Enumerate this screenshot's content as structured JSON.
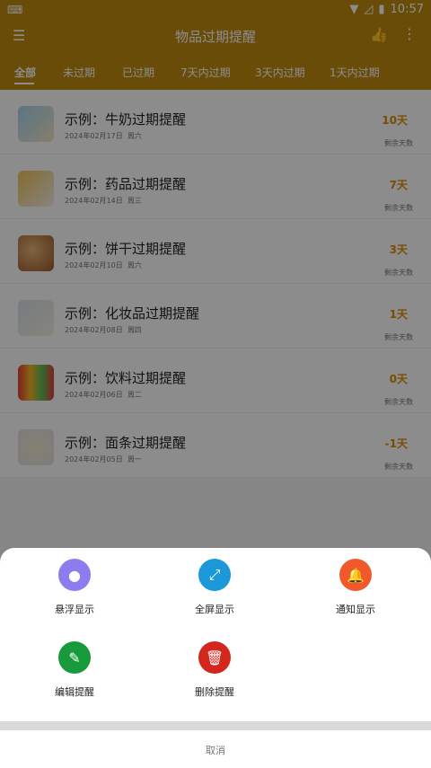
{
  "status_bar": {
    "keyboard_icon": "keyboard-icon",
    "wifi_icon": "wifi-icon",
    "signal_icon": "signal-off-icon",
    "battery_icon": "battery-icon",
    "time": "10:57"
  },
  "app_bar": {
    "title": "物品过期提醒",
    "menu_icon": "menu-icon",
    "like_icon": "thumbs-up-icon",
    "more_icon": "more-vertical-icon"
  },
  "tabs": [
    {
      "label": "全部"
    },
    {
      "label": "未过期"
    },
    {
      "label": "已过期"
    },
    {
      "label": "7天内过期"
    },
    {
      "label": "3天内过期"
    },
    {
      "label": "1天内过期"
    }
  ],
  "items": [
    {
      "title": "示例：牛奶过期提醒",
      "date": "2024年02月17日",
      "weekday": "周六",
      "days": "10天",
      "remain_label": "剩余天数"
    },
    {
      "title": "示例：药品过期提醒",
      "date": "2024年02月14日",
      "weekday": "周三",
      "days": "7天",
      "remain_label": "剩余天数"
    },
    {
      "title": "示例：饼干过期提醒",
      "date": "2024年02月10日",
      "weekday": "周六",
      "days": "3天",
      "remain_label": "剩余天数"
    },
    {
      "title": "示例：化妆品过期提醒",
      "date": "2024年02月08日",
      "weekday": "周四",
      "days": "1天",
      "remain_label": "剩余天数"
    },
    {
      "title": "示例：饮料过期提醒",
      "date": "2024年02月06日",
      "weekday": "周二",
      "days": "0天",
      "remain_label": "剩余天数"
    },
    {
      "title": "示例：面条过期提醒",
      "date": "2024年02月05日",
      "weekday": "周一",
      "days": "-1天",
      "remain_label": "剩余天数"
    }
  ],
  "sheet": {
    "actions": [
      {
        "label": "悬浮显示",
        "color": "#8b7cf0",
        "icon": "float-icon"
      },
      {
        "label": "全屏显示",
        "color": "#1a98d8",
        "icon": "fullscreen-icon"
      },
      {
        "label": "通知显示",
        "color": "#f05a2a",
        "icon": "bell-icon"
      },
      {
        "label": "编辑提醒",
        "color": "#169a3a",
        "icon": "edit-icon"
      },
      {
        "label": "删除提醒",
        "color": "#d3261c",
        "icon": "trash-icon"
      }
    ],
    "cancel_label": "取消"
  },
  "colors": {
    "primary": "#c28b12",
    "days_accent": "#e08a00",
    "overlay": "rgba(0,0,0,0.45)"
  }
}
